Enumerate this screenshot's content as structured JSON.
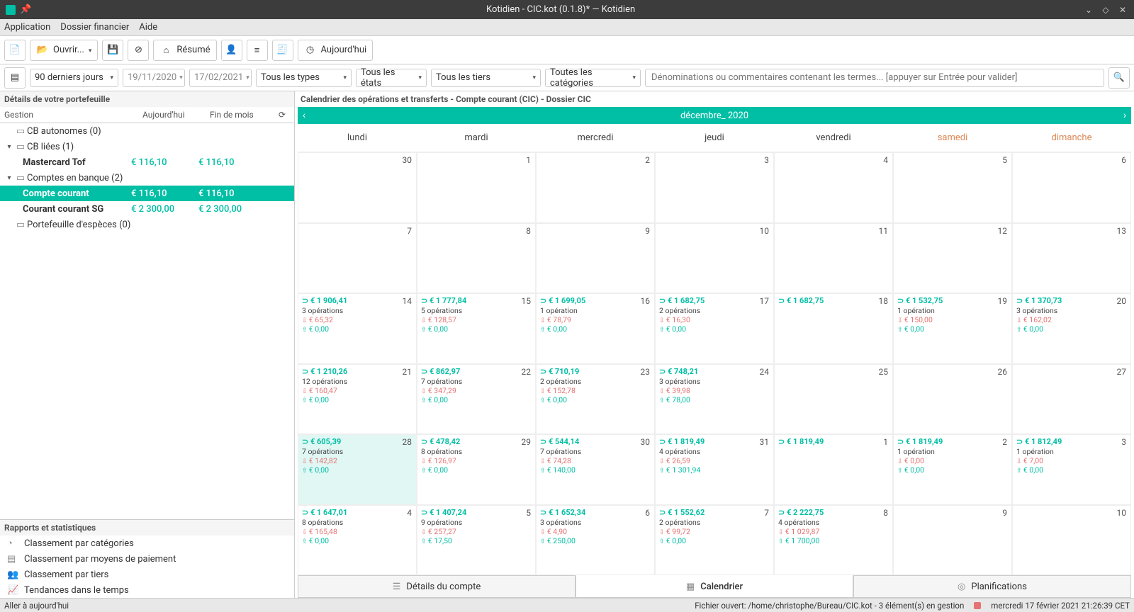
{
  "window": {
    "title": "Kotidien - CIC.kot (0.1.8)* — Kotidien"
  },
  "menubar": [
    "Application",
    "Dossier financier",
    "Aide"
  ],
  "toolbar": {
    "open_label": "Ouvrir...",
    "resume_label": "Résumé",
    "today_label": "Aujourd'hui"
  },
  "filters": {
    "range": "90 derniers jours",
    "date_from": "19/11/2020",
    "date_to": "17/02/2021",
    "types": "Tous les types",
    "states": "Tous les états",
    "thirds": "Tous les tiers",
    "categories": "Toutes les catégories",
    "search_placeholder": "Dénominations ou commentaires contenant les termes... [appuyer sur Entrée pour valider]"
  },
  "portfolio": {
    "title": "Détails de votre portefeuille",
    "cols": {
      "c1": "Gestion",
      "c2": "Aujourd'hui",
      "c3": "Fin de mois"
    },
    "rows": [
      {
        "type": "group",
        "name": "CB autonomes (0)",
        "exp": ""
      },
      {
        "type": "group",
        "name": "CB liées (1)",
        "exp": "▾"
      },
      {
        "type": "child",
        "name": "Mastercard Tof",
        "v1": "€ 116,10",
        "v2": "€ 116,10",
        "bold": true
      },
      {
        "type": "group",
        "name": "Comptes en banque (2)",
        "exp": "▾"
      },
      {
        "type": "child",
        "name": "Compte courant",
        "v1": "€ 116,10",
        "v2": "€ 116,10",
        "bold": true,
        "selected": true
      },
      {
        "type": "child",
        "name": "Courant courant SG",
        "v1": "€ 2 300,00",
        "v2": "€ 2 300,00",
        "bold": true
      },
      {
        "type": "group",
        "name": "Portefeuille d'espèces (0)",
        "exp": ""
      }
    ]
  },
  "reports": {
    "title": "Rapports et statistiques",
    "items": [
      "Classement par catégories",
      "Classement par moyens de paiement",
      "Classement par tiers",
      "Tendances dans le temps"
    ]
  },
  "calendar": {
    "title": "Calendrier des opérations et transferts - Compte courant (CIC) - Dossier CIC",
    "month": "décembre_   2020",
    "daynames": [
      "lundi",
      "mardi",
      "mercredi",
      "jeudi",
      "vendredi",
      "samedi",
      "dimanche"
    ],
    "cells": [
      {
        "num": "30"
      },
      {
        "num": "1"
      },
      {
        "num": "2"
      },
      {
        "num": "3"
      },
      {
        "num": "4"
      },
      {
        "num": "5"
      },
      {
        "num": "6"
      },
      {
        "num": "7"
      },
      {
        "num": "8"
      },
      {
        "num": "9"
      },
      {
        "num": "10"
      },
      {
        "num": "11"
      },
      {
        "num": "12"
      },
      {
        "num": "13"
      },
      {
        "num": "14",
        "bal": "€ 1 906,41",
        "ops": "3 opérations",
        "down": "€ 65,32",
        "up": "€ 0,00"
      },
      {
        "num": "15",
        "bal": "€ 1 777,84",
        "ops": "5 opérations",
        "down": "€ 128,57",
        "up": "€ 0,00"
      },
      {
        "num": "16",
        "bal": "€ 1 699,05",
        "ops": "1 opération",
        "down": "€ 78,79",
        "up": "€ 0,00"
      },
      {
        "num": "17",
        "bal": "€ 1 682,75",
        "ops": "2 opérations",
        "down": "€ 16,30",
        "up": "€ 0,00"
      },
      {
        "num": "18",
        "bal": "€ 1 682,75"
      },
      {
        "num": "19",
        "bal": "€ 1 532,75",
        "ops": "1 opération",
        "down": "€ 150,00",
        "up": "€ 0,00"
      },
      {
        "num": "20",
        "bal": "€ 1 370,73",
        "ops": "3 opérations",
        "down": "€ 162,02",
        "up": "€ 0,00"
      },
      {
        "num": "21",
        "bal": "€ 1 210,26",
        "ops": "12 opérations",
        "down": "€ 160,47",
        "up": "€ 0,00"
      },
      {
        "num": "22",
        "bal": "€ 862,97",
        "ops": "7 opérations",
        "down": "€ 347,29",
        "up": "€ 0,00"
      },
      {
        "num": "23",
        "bal": "€ 710,19",
        "ops": "2 opérations",
        "down": "€ 152,78",
        "up": "€ 0,00"
      },
      {
        "num": "24",
        "bal": "€ 748,21",
        "ops": "3 opérations",
        "down": "€ 39,98",
        "up": "€ 78,00"
      },
      {
        "num": "25"
      },
      {
        "num": "26"
      },
      {
        "num": "27"
      },
      {
        "num": "28",
        "bal": "€ 605,39",
        "ops": "7 opérations",
        "down": "€ 142,82",
        "up": "€ 0,00",
        "hl": true
      },
      {
        "num": "29",
        "bal": "€ 478,42",
        "ops": "8 opérations",
        "down": "€ 126,97",
        "up": "€ 0,00"
      },
      {
        "num": "30",
        "bal": "€ 544,14",
        "ops": "7 opérations",
        "down": "€ 74,28",
        "up": "€ 140,00"
      },
      {
        "num": "31",
        "bal": "€ 1 819,49",
        "ops": "4 opérations",
        "down": "€ 26,59",
        "up": "€ 1 301,94"
      },
      {
        "num": "1",
        "bal": "€ 1 819,49"
      },
      {
        "num": "2",
        "bal": "€ 1 819,49",
        "ops": "1 opération",
        "down": "€ 0,00",
        "up": "€ 0,00"
      },
      {
        "num": "3",
        "bal": "€ 1 812,49",
        "ops": "1 opération",
        "down": "€ 7,00",
        "up": "€ 0,00"
      },
      {
        "num": "4",
        "bal": "€ 1 647,01",
        "ops": "8 opérations",
        "down": "€ 165,48",
        "up": "€ 0,00"
      },
      {
        "num": "5",
        "bal": "€ 1 407,24",
        "ops": "9 opérations",
        "down": "€ 257,27",
        "up": "€ 17,50"
      },
      {
        "num": "6",
        "bal": "€ 1 652,34",
        "ops": "3 opérations",
        "down": "€ 4,90",
        "up": "€ 250,00"
      },
      {
        "num": "7",
        "bal": "€ 1 552,62",
        "ops": "2 opérations",
        "down": "€ 99,72",
        "up": "€ 0,00"
      },
      {
        "num": "8",
        "bal": "€ 2 222,75",
        "ops": "4 opérations",
        "down": "€ 1 029,87",
        "up": "€ 1 700,00"
      },
      {
        "num": "9"
      },
      {
        "num": "10"
      }
    ]
  },
  "tabs": {
    "details": "Détails du compte",
    "calendar": "Calendrier",
    "planning": "Planifications"
  },
  "status": {
    "left": "Aller à aujourd'hui",
    "file": "Fichier ouvert: /home/christophe/Bureau/CIC.kot - 3 élément(s) en gestion",
    "datetime": "mercredi 17 février 2021 21:26:39 CET"
  }
}
